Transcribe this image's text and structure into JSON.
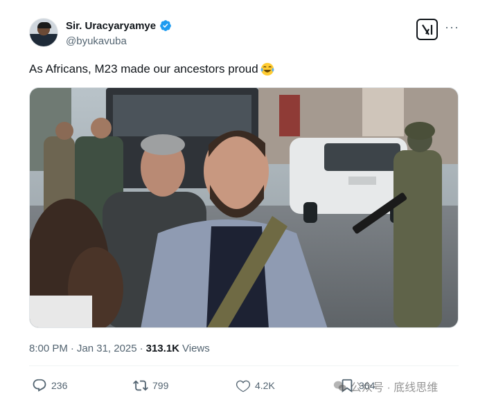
{
  "author": {
    "display_name": "Sir. Uracyaryamye",
    "handle": "@byukavuba",
    "verified": true
  },
  "tweet": {
    "text": "As Africans, M23 made our ancestors proud",
    "emoji": "face-with-tears-of-joy-icon"
  },
  "meta": {
    "time": "8:00 PM",
    "separator": "·",
    "date": "Jan 31, 2025",
    "views_count": "313.1K",
    "views_label": "Views"
  },
  "actions": {
    "replies": "236",
    "reposts": "799",
    "likes": "4.2K",
    "bookmarks": "364"
  },
  "watermark": {
    "text": "公众号 · 底线思维"
  },
  "colors": {
    "verified_blue": "#1d9bf0",
    "text_primary": "#0f1419",
    "text_secondary": "#536471"
  }
}
